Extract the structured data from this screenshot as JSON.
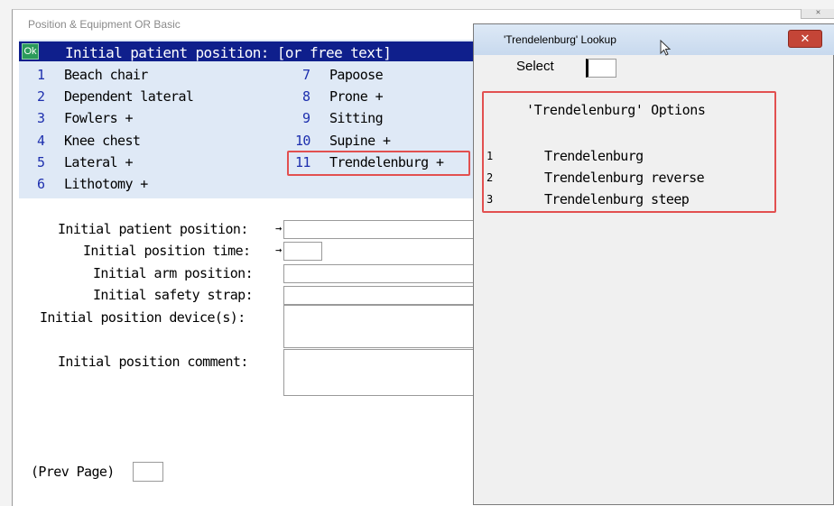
{
  "main_window": {
    "title": "Position & Equipment OR Basic",
    "close_glyph": "✕"
  },
  "list": {
    "ok_label": "Ok",
    "header": "Initial patient position: [or free text]",
    "left_options": [
      {
        "num": "1",
        "label": "Beach chair"
      },
      {
        "num": "2",
        "label": "Dependent lateral"
      },
      {
        "num": "3",
        "label": "Fowlers +"
      },
      {
        "num": "4",
        "label": "Knee chest"
      },
      {
        "num": "5",
        "label": "Lateral +"
      },
      {
        "num": "6",
        "label": "Lithotomy +"
      }
    ],
    "right_options": [
      {
        "num": "7",
        "label": "Papoose"
      },
      {
        "num": "8",
        "label": "Prone +"
      },
      {
        "num": "9",
        "label": "Sitting"
      },
      {
        "num": "10",
        "label": "Supine +"
      },
      {
        "num": "11",
        "label": "Trendelenburg +"
      }
    ]
  },
  "form": {
    "initial_patient_position": {
      "label": "Initial patient position:",
      "value": ""
    },
    "initial_position_time": {
      "label": "Initial position time:",
      "value": ""
    },
    "initial_arm_position": {
      "label": "Initial arm position:",
      "value": ""
    },
    "initial_safety_strap": {
      "label": "Initial safety strap:",
      "value": ""
    },
    "initial_position_devices": {
      "label": "Initial position device(s):",
      "value": ""
    },
    "initial_position_comment": {
      "label": "Initial position comment:",
      "value": ""
    },
    "prev_page": {
      "label": "(Prev Page)",
      "value": ""
    },
    "arrow_glyph": "→"
  },
  "lookup": {
    "title": "'Trendelenburg' Lookup",
    "close_glyph": "✕",
    "select_label": "Select",
    "select_value": "",
    "options_title": "'Trendelenburg' Options",
    "options": [
      {
        "num": "1",
        "label": "Trendelenburg"
      },
      {
        "num": "2",
        "label": "Trendelenburg reverse"
      },
      {
        "num": "3",
        "label": "Trendelenburg steep"
      }
    ]
  },
  "cursor_icon": "mouse-pointer-icon",
  "colors": {
    "header_bg": "#0f1f8c",
    "list_bg": "#dfe9f6",
    "number_color": "#1d2fae",
    "highlight": "#e25050",
    "ok_green": "#2a9a5a"
  }
}
